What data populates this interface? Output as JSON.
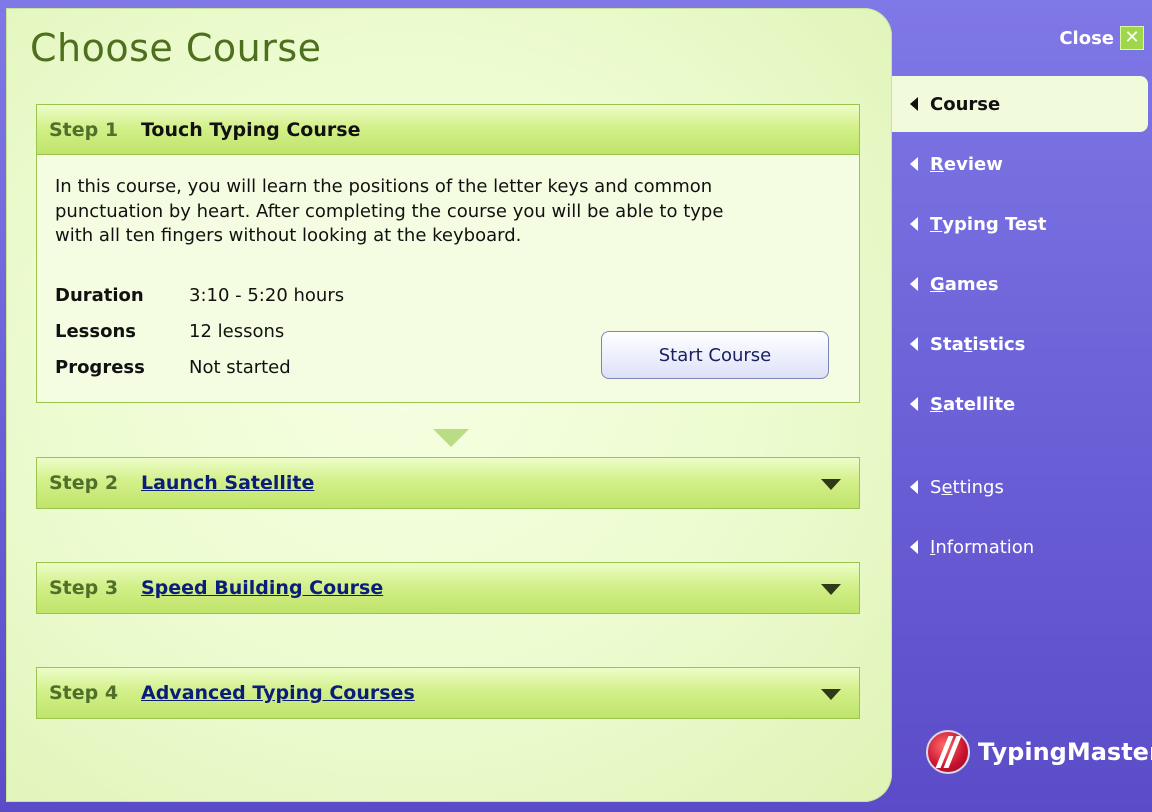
{
  "page": {
    "title": "Choose Course"
  },
  "close": {
    "label": "Close",
    "icon": "close-icon"
  },
  "steps": [
    {
      "num": "Step 1",
      "title": "Touch Typing Course",
      "description": "In this course, you will learn the positions of the letter keys and common punctuation by heart. After completing the course you will be able to type with all ten fingers without looking at the keyboard.",
      "info": [
        {
          "label": "Duration",
          "value": "3:10 - 5:20 hours"
        },
        {
          "label": "Lessons",
          "value": "12 lessons"
        },
        {
          "label": "Progress",
          "value": "Not started"
        }
      ],
      "button": "Start Course"
    },
    {
      "num": "Step 2",
      "title": "Launch Satellite"
    },
    {
      "num": "Step 3",
      "title": "Speed Building Course"
    },
    {
      "num": "Step 4",
      "title": "Advanced Typing Courses"
    }
  ],
  "nav": {
    "items": [
      {
        "label": "Course",
        "active": true
      },
      {
        "label": "Review",
        "first": "R",
        "rest": "eview"
      },
      {
        "label": "Typing Test",
        "first": "T",
        "rest": "yping Test"
      },
      {
        "label": "Games",
        "first": "G",
        "rest": "ames"
      },
      {
        "label": "Statistics",
        "pre": "Sta",
        "ul": "t",
        "post": "istics"
      },
      {
        "label": "Satellite",
        "first": "S",
        "rest": "atellite"
      },
      {
        "label": "Settings",
        "pre": "S",
        "ul": "e",
        "post": "ttings"
      },
      {
        "label": "Information",
        "first": "I",
        "rest": "nformation"
      }
    ]
  },
  "brand": {
    "name": "TypingMaster"
  },
  "colors": {
    "sidebar": "#6a5fd6",
    "panel": "#ecfbcf",
    "header_green": "#c9ea78",
    "link": "#0b1d7a",
    "title": "#4d6f1e"
  }
}
